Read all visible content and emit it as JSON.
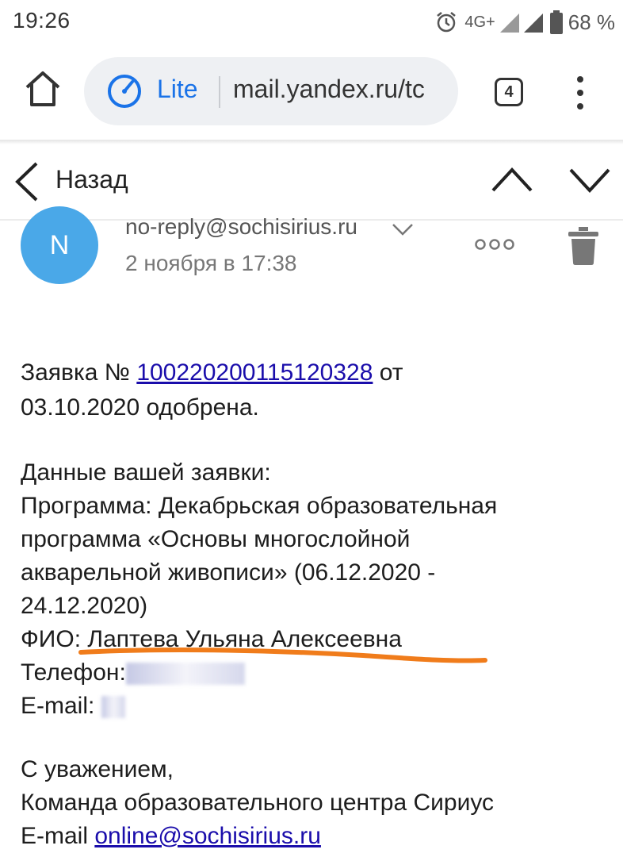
{
  "status": {
    "time": "19:26",
    "network": "4G+",
    "battery": "68 %"
  },
  "browser": {
    "mode_label": "Lite",
    "url": "mail.yandex.ru/tc",
    "tab_count": "4"
  },
  "nav": {
    "back_label": "Назад"
  },
  "message": {
    "avatar_letter": "N",
    "sender": "no-reply@sochisirius.ru",
    "date": "2 ноября в 17:38",
    "line1_prefix": "Заявка № ",
    "application_number": "100220200115120328",
    "line1_suffix": " от",
    "line2": "03.10.2020 одобрена.",
    "data_heading": "Данные вашей заявки:",
    "program_line1": "Программа: Декабрьская образовательная",
    "program_line2": "программа «Основы многослойной",
    "program_line3": "акварельной живописи» (06.12.2020 -",
    "program_line4": "24.12.2020)",
    "fio_line": "ФИО: Лаптева Ульяна Алексеевна",
    "phone_label": "Телефон:",
    "email_label": "E-mail:",
    "regards": "С уважением,",
    "team": "Команда образовательного центра Сириус",
    "footer_email_label": "E-mail ",
    "footer_email": "online@sochisirius.ru"
  },
  "colors": {
    "accent": "#1a73e8",
    "link": "#1a0dab",
    "avatar": "#4aa8e8",
    "highlight": "#f07c1b"
  },
  "icons": [
    "alarm-icon",
    "signal-icon",
    "battery-icon",
    "home-icon",
    "lite-speed-icon",
    "tabs-icon",
    "menu-dots-icon",
    "back-chevron-icon",
    "up-chevron-icon",
    "down-chevron-icon",
    "expand-sender-icon",
    "more-dots-icon",
    "trash-icon"
  ]
}
